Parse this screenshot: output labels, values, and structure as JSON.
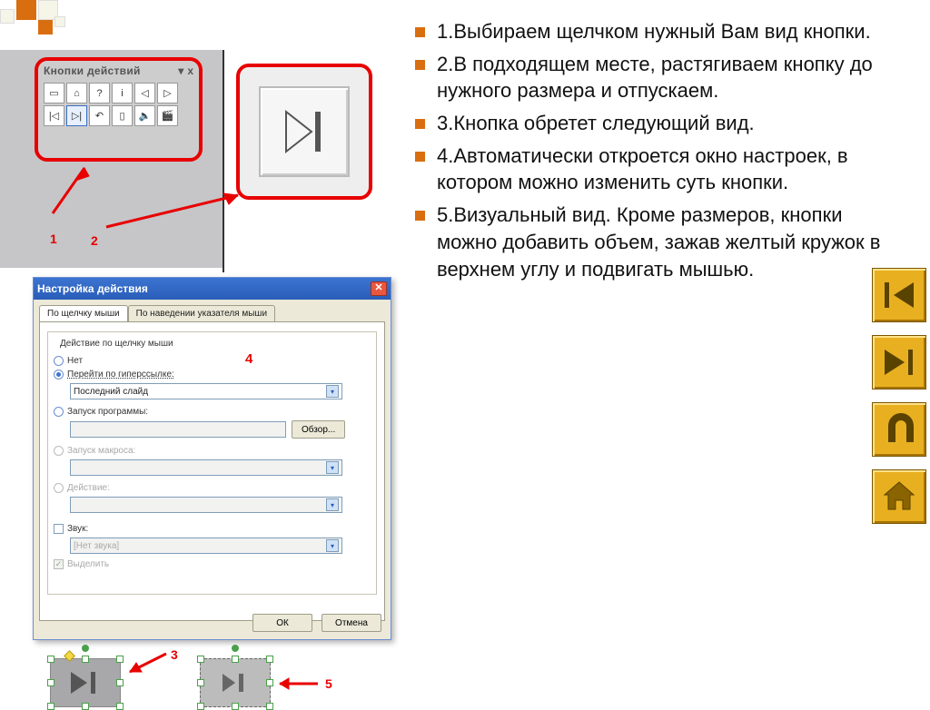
{
  "deco": {
    "present": true
  },
  "toolbar": {
    "title": "Кнопки действий",
    "menu_icon": "▾",
    "close_icon": "x"
  },
  "labels": {
    "n1": "1",
    "n2": "2",
    "n3": "3",
    "n4": "4",
    "n5": "5"
  },
  "dialog": {
    "title": "Настройка действия",
    "tabs": [
      "По щелчку мыши",
      "По наведении указателя мыши"
    ],
    "group_title": "Действие по щелчку мыши",
    "opt_none": "Нет",
    "opt_hyperlink": "Перейти по гиперссылке:",
    "hyperlink_value": "Последний слайд",
    "opt_run_prog": "Запуск программы:",
    "browse": "Обзор...",
    "opt_macro": "Запуск макроса:",
    "opt_action": "Действие:",
    "chk_sound": "Звук:",
    "sound_value": "[Нет звука]",
    "chk_highlight": "Выделить",
    "ok": "ОК",
    "cancel": "Отмена"
  },
  "right_text": {
    "items": [
      "1.Выбираем щелчком нужный Вам вид кнопки.",
      "2.В подходящем месте, растягиваем кнопку до нужного размера и отпускаем.",
      "3.Кнопка обретет следующий вид.",
      "4.Автоматически откроется окно настроек, в котором можно изменить суть кнопки.",
      "5.Визуальный вид. Кроме размеров, кнопки можно добавить объем, зажав желтый кружок в верхнем углу и подвигать мышью."
    ]
  },
  "ybtns": {
    "names": [
      "prev",
      "next",
      "return",
      "home"
    ]
  }
}
